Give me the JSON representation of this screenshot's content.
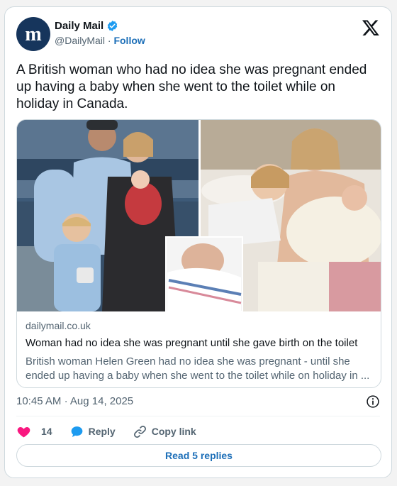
{
  "account": {
    "name": "Daily Mail",
    "handle": "@DailyMail",
    "separator": "·",
    "follow_label": "Follow",
    "avatar_icon": "daily-mail-logo",
    "avatar_color": "#16355c",
    "verified_color": "#1d9bf0"
  },
  "post": {
    "text": "A British woman who had no idea she was pregnant ended up having a baby when she went to the toilet while on holiday in Canada."
  },
  "link_card": {
    "domain": "dailymail.co.uk",
    "title": "Woman had no idea she was pregnant until she gave birth on the toilet",
    "description_line1": "British woman Helen Green had no idea she was pregnant - until she",
    "description_line2": "ended up having a baby when she went to the toilet while on holiday in ..."
  },
  "meta": {
    "time": "10:45 AM",
    "separator": "·",
    "date": "Aug 14, 2025"
  },
  "actions": {
    "likes_count": "14",
    "reply_label": "Reply",
    "copy_label": "Copy link",
    "like_color": "#f91880",
    "reply_color": "#1d9bf0"
  },
  "replies_button": "Read 5 replies",
  "accent": "#1d6fb8"
}
